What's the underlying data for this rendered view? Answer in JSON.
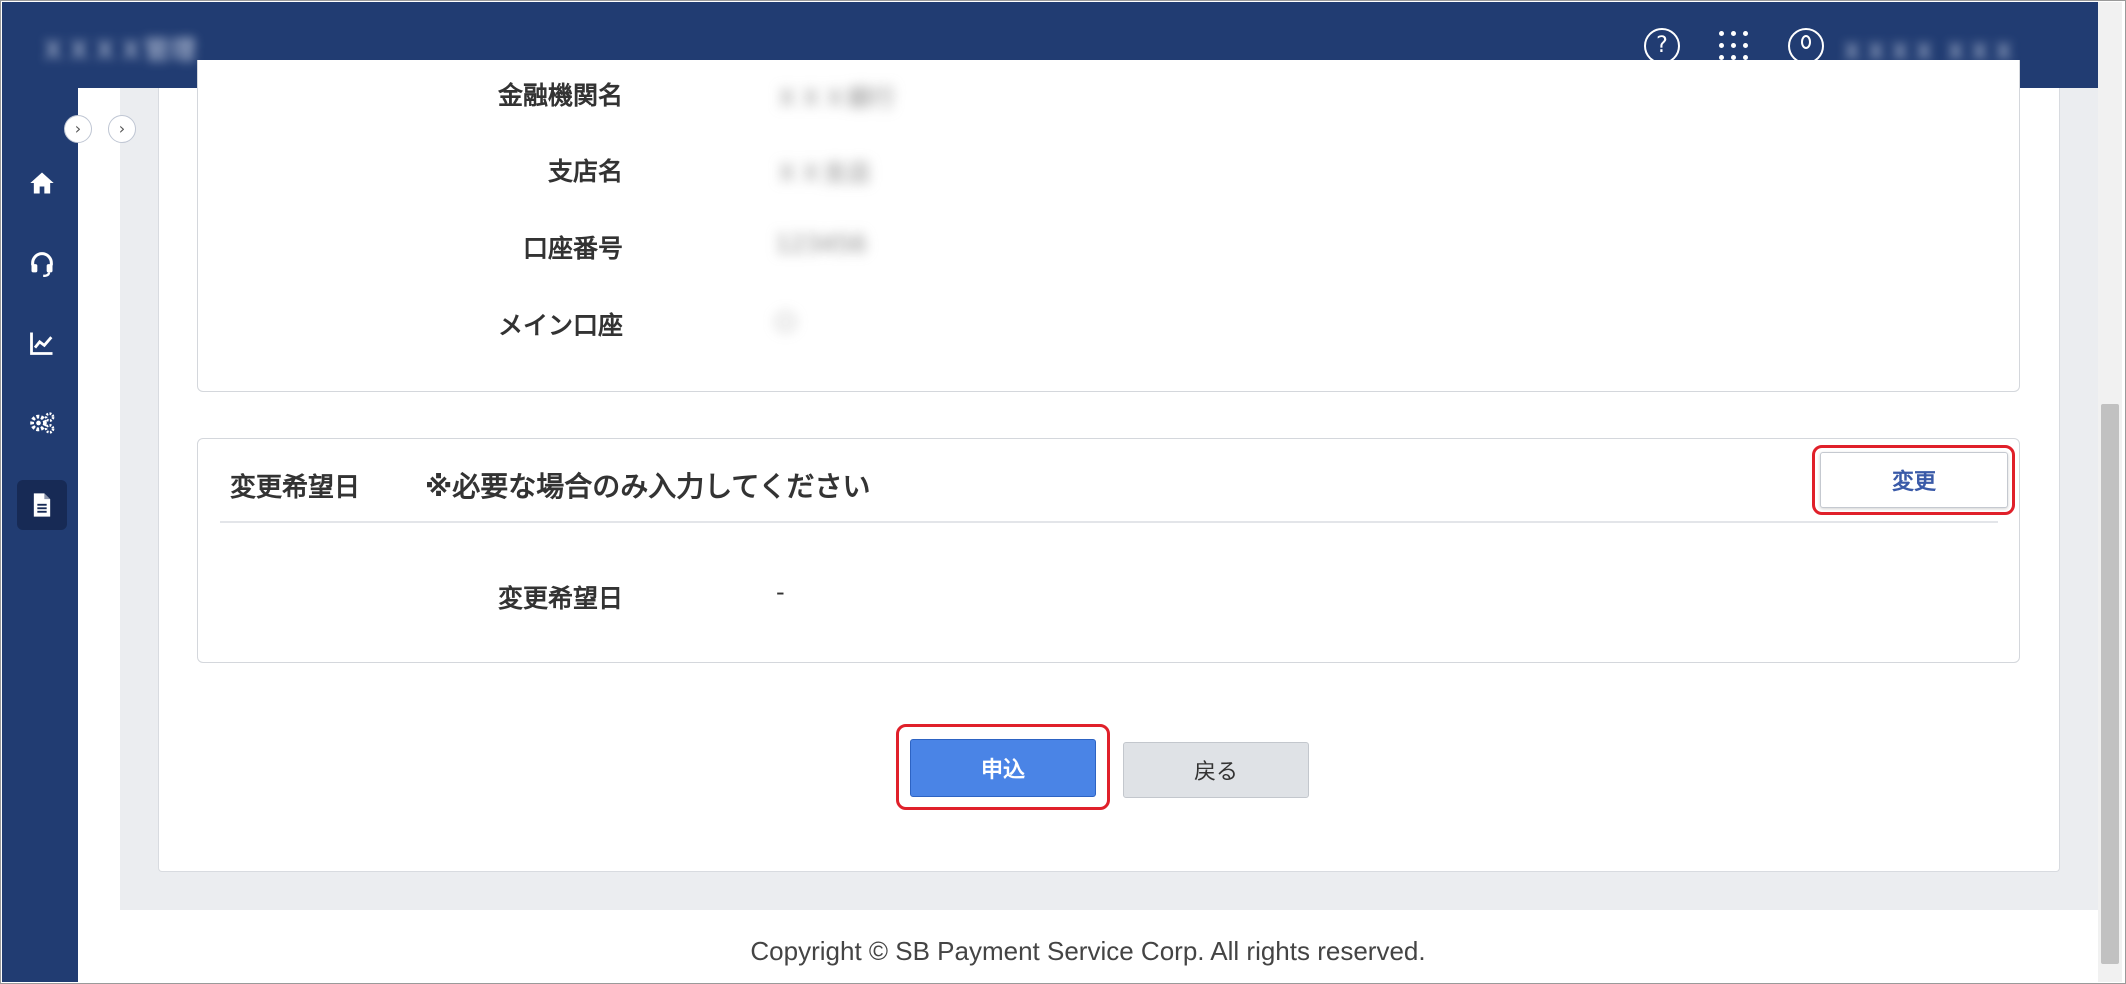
{
  "header": {
    "brand": "ＸＸＸＸ管理",
    "user_name": "ＸＸＸＸ ＸＸＸ",
    "help_icon_glyph": "?"
  },
  "sidebar": {
    "toggle_glyph": "›",
    "items": [
      {
        "icon": "home-icon"
      },
      {
        "icon": "headset-icon"
      },
      {
        "icon": "chart-icon"
      },
      {
        "icon": "gears-icon"
      },
      {
        "icon": "document-icon",
        "active": true
      }
    ]
  },
  "account_panel": {
    "rows": [
      {
        "label": "金融機関名",
        "value": "ＸＸＸ銀行"
      },
      {
        "label": "支店名",
        "value": "ＸＸ支店"
      },
      {
        "label": "口座番号",
        "value": "123456"
      },
      {
        "label": "メイン口座",
        "value": "○"
      }
    ]
  },
  "date_panel": {
    "title": "変更希望日",
    "note": "※必要な場合のみ入力してください",
    "change_button": "変更",
    "field_label": "変更希望日",
    "field_value": "-"
  },
  "actions": {
    "submit_label": "申込",
    "back_label": "戻る"
  },
  "footer": {
    "copyright": "Copyright © SB Payment Service Corp. All rights reserved."
  },
  "colors": {
    "navy": "#213c72",
    "primary": "#4a84e6",
    "highlight": "#e0202a"
  }
}
